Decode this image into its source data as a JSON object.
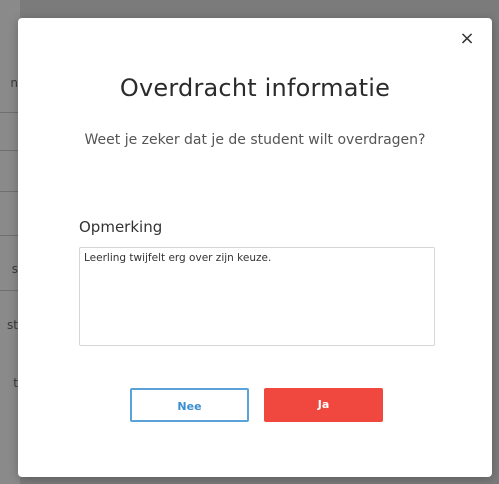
{
  "background": {
    "fragments": [
      "n",
      "s",
      "st",
      "t"
    ]
  },
  "modal": {
    "close_label": "×",
    "title": "Overdracht informatie",
    "subtitle": "Weet je zeker dat je de student wilt overdragen?",
    "field_label": "Opmerking",
    "remark_value": "Leerling twijfelt erg over zijn keuze.",
    "buttons": {
      "cancel_label": "Nee",
      "confirm_label": "Ja"
    }
  },
  "colors": {
    "overlay": "#7b7b7b",
    "cancel_border": "#5aa2d8",
    "confirm_bg": "#f0483e"
  }
}
